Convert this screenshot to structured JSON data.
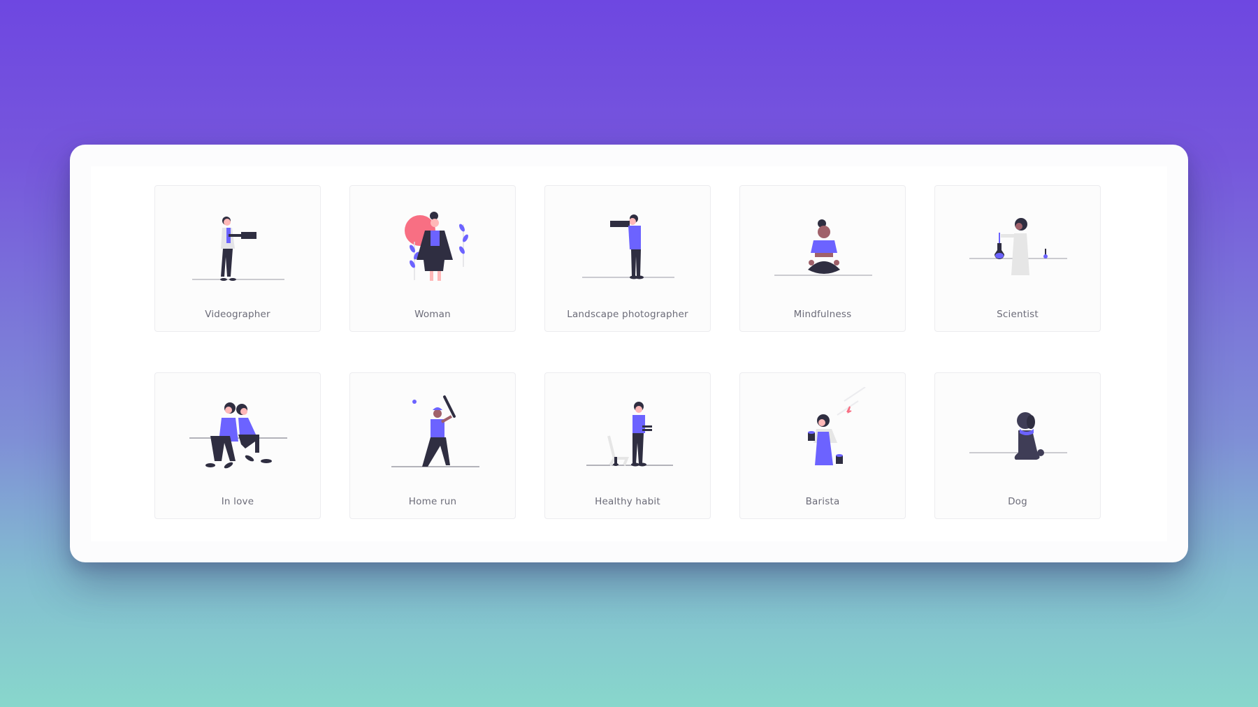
{
  "gallery": {
    "items": [
      {
        "label": "Videographer",
        "icon": "videographer-illustration"
      },
      {
        "label": "Woman",
        "icon": "woman-illustration"
      },
      {
        "label": "Landscape photographer",
        "icon": "landscape-photographer-illustration"
      },
      {
        "label": "Mindfulness",
        "icon": "mindfulness-illustration"
      },
      {
        "label": "Scientist",
        "icon": "scientist-illustration"
      },
      {
        "label": "In love",
        "icon": "in-love-illustration"
      },
      {
        "label": "Home run",
        "icon": "home-run-illustration"
      },
      {
        "label": "Healthy habit",
        "icon": "healthy-habit-illustration"
      },
      {
        "label": "Barista",
        "icon": "barista-illustration"
      },
      {
        "label": "Dog",
        "icon": "dog-illustration"
      }
    ]
  },
  "colors": {
    "accent": "#6c63ff",
    "dark": "#2f2e41",
    "skin": "#ffb8b8",
    "pink": "#f86f83"
  }
}
